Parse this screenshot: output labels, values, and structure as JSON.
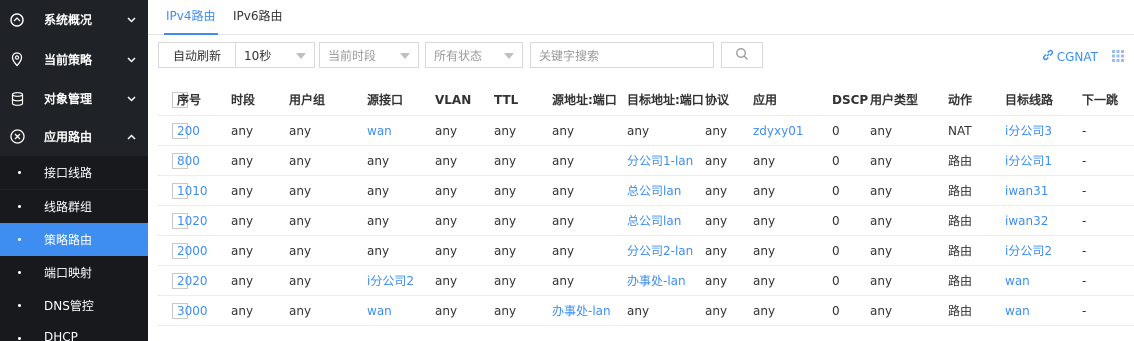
{
  "sidebar": {
    "items": [
      {
        "label": "系统概况",
        "icon": "dashboard-icon",
        "chevron": "chevron-down-icon"
      },
      {
        "label": "当前策略",
        "icon": "location-pin-icon",
        "chevron": "chevron-down-icon"
      },
      {
        "label": "对象管理",
        "icon": "database-icon",
        "chevron": "chevron-down-icon"
      },
      {
        "label": "应用路由",
        "icon": "close-circle-icon",
        "chevron": "chevron-up-icon"
      }
    ],
    "sub_items": [
      "接口线路",
      "线路群组",
      "策略路由",
      "端口映射",
      "DNS管控",
      "DHCP"
    ],
    "active_sub": "策略路由"
  },
  "tabs": [
    "IPv4路由",
    "IPv6路由"
  ],
  "active_tab": "IPv4路由",
  "toolbar": {
    "auto_refresh": "自动刷新",
    "interval": "10秒",
    "period": "当前时段",
    "status": "所有状态",
    "search_placeholder": "关键字搜索",
    "cgnat": "CGNAT"
  },
  "table": {
    "headers": [
      "序号",
      "时段",
      "用户组",
      "源接口",
      "VLAN",
      "TTL",
      "源地址:端口",
      "目标地址:端口",
      "协议",
      "应用",
      "DSCP",
      "用户类型",
      "动作",
      "目标线路",
      "下一跳"
    ],
    "rows": [
      [
        "200",
        "any",
        "any",
        "wan",
        "any",
        "any",
        "any",
        "any",
        "any",
        "zdyxy01",
        "0",
        "any",
        "NAT",
        "i分公司3",
        "-"
      ],
      [
        "800",
        "any",
        "any",
        "any",
        "any",
        "any",
        "any",
        "分公司1-lan",
        "any",
        "any",
        "0",
        "any",
        "路由",
        "i分公司1",
        "-"
      ],
      [
        "1010",
        "any",
        "any",
        "any",
        "any",
        "any",
        "any",
        "总公司lan",
        "any",
        "any",
        "0",
        "any",
        "路由",
        "iwan31",
        "-"
      ],
      [
        "1020",
        "any",
        "any",
        "any",
        "any",
        "any",
        "any",
        "总公司lan",
        "any",
        "any",
        "0",
        "any",
        "路由",
        "iwan32",
        "-"
      ],
      [
        "2000",
        "any",
        "any",
        "any",
        "any",
        "any",
        "any",
        "分公司2-lan",
        "any",
        "any",
        "0",
        "any",
        "路由",
        "i分公司2",
        "-"
      ],
      [
        "2020",
        "any",
        "any",
        "i分公司2",
        "any",
        "any",
        "any",
        "办事处-lan",
        "any",
        "any",
        "0",
        "any",
        "路由",
        "wan",
        "-"
      ],
      [
        "3000",
        "any",
        "any",
        "wan",
        "any",
        "any",
        "办事处-lan",
        "any",
        "any",
        "any",
        "0",
        "any",
        "路由",
        "wan",
        "-"
      ]
    ]
  },
  "colors": {
    "accent": "#3d8ef0",
    "sidebar": "#1f2227"
  }
}
